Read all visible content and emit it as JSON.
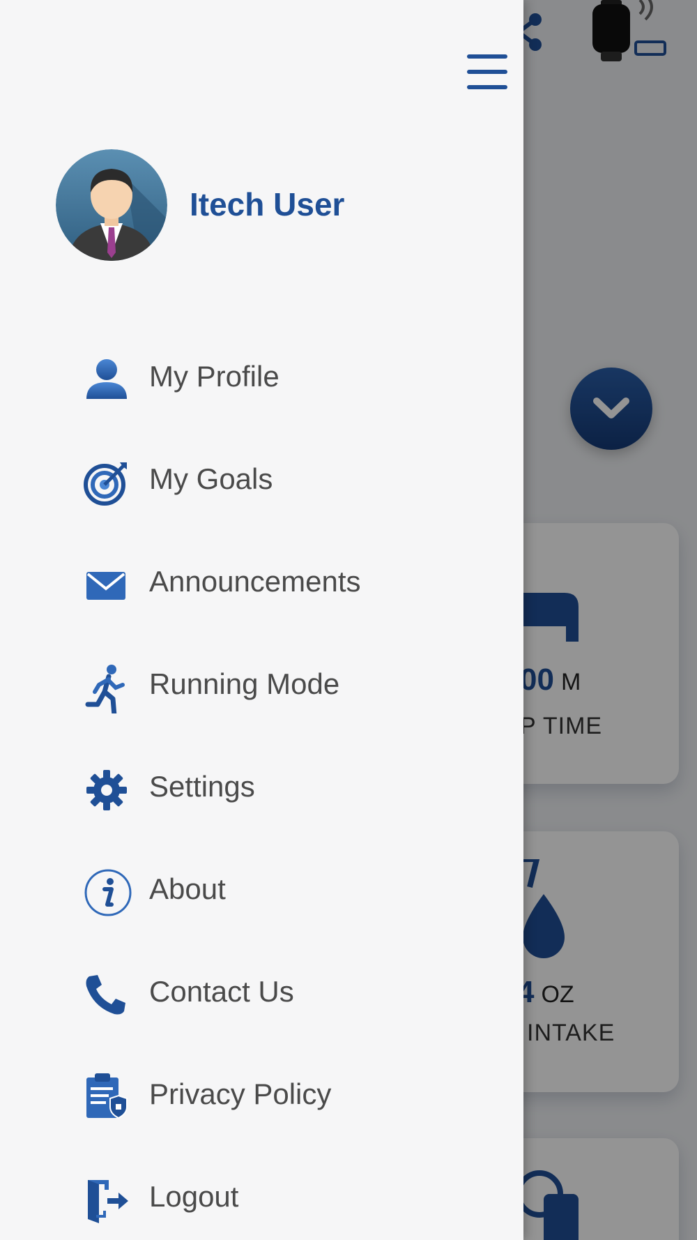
{
  "colors": {
    "accent": "#1f4f96",
    "accent_light": "#4a86d4",
    "drawer_bg": "#f6f6f7",
    "menu_text": "#4a4a4a"
  },
  "drawer": {
    "toggle_icon": "hamburger-menu-icon",
    "user": {
      "name": "Itech User",
      "avatar_icon": "avatar-icon"
    },
    "menu": [
      {
        "label": "My Profile",
        "icon": "user-icon"
      },
      {
        "label": "My Goals",
        "icon": "target-icon"
      },
      {
        "label": "Announcements",
        "icon": "envelope-icon"
      },
      {
        "label": "Running Mode",
        "icon": "runner-icon"
      },
      {
        "label": "Settings",
        "icon": "gear-icon"
      },
      {
        "label": "About",
        "icon": "info-icon"
      },
      {
        "label": "Contact Us",
        "icon": "phone-icon"
      },
      {
        "label": "Privacy Policy",
        "icon": "clipboard-shield-icon"
      },
      {
        "label": "Logout",
        "icon": "logout-door-icon"
      }
    ]
  },
  "background": {
    "header_icons": [
      "share-icon",
      "smartwatch-icon",
      "battery-icon"
    ],
    "expand_icon": "chevron-down-icon",
    "cards": [
      {
        "value": "00",
        "unit": "M",
        "label": "P TIME",
        "icon": "bed-icon"
      },
      {
        "value": "4",
        "unit": "OZ",
        "label": "INTAKE",
        "icon": "water-drop-icon"
      },
      {
        "value": "",
        "unit": "",
        "label": "",
        "icon": "scale-icon"
      }
    ]
  }
}
